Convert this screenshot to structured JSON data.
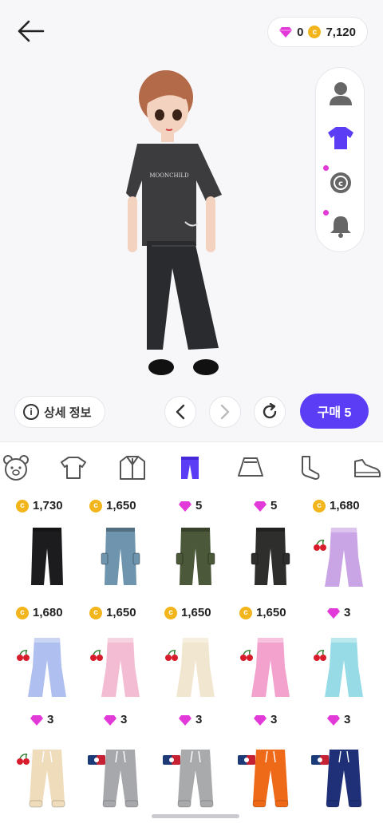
{
  "header": {
    "gems": "0",
    "coins": "7,120"
  },
  "actions": {
    "detail_label": "상세 정보",
    "buy_label": "구매 5"
  },
  "avatar": {
    "shirt_text": "MOONCHILD"
  },
  "side_panel": [
    "face-icon",
    "shirt-icon",
    "sticker-icon",
    "bell-icon"
  ],
  "tabs": [
    "bear-face-icon",
    "tshirt-icon",
    "jacket-icon",
    "pants-icon",
    "skirt-icon",
    "sock-icon",
    "sneaker-icon"
  ],
  "colors": {
    "accent": "#5b3df5",
    "gem": "#e23ad8",
    "coin": "#f2b51b"
  },
  "items": {
    "row0_prices": [
      "1,730",
      "1,650",
      "5",
      "5",
      "1,680"
    ],
    "row0_currency": [
      "coin",
      "coin",
      "gem",
      "gem",
      "coin"
    ],
    "row1_prices": [
      "1,680",
      "1,650",
      "1,650",
      "1,650",
      "3"
    ],
    "row1_currency": [
      "coin",
      "coin",
      "coin",
      "coin",
      "gem"
    ],
    "row2_prices": [
      "3",
      "3",
      "3",
      "3",
      "3"
    ],
    "row2_currency": [
      "gem",
      "gem",
      "gem",
      "gem",
      "gem"
    ]
  }
}
